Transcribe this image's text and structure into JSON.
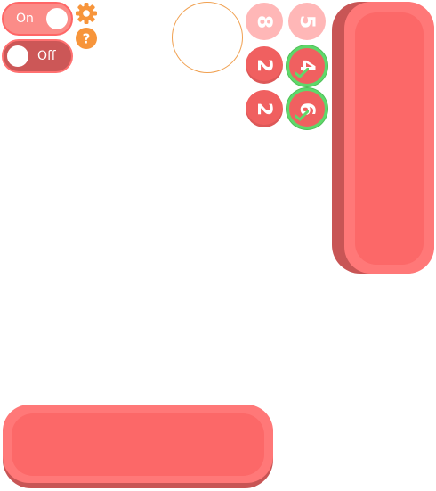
{
  "toggles": {
    "on_label": "On",
    "off_label": "Off"
  },
  "icons": {
    "settings": "gear-icon",
    "help": "help-icon",
    "help_glyph": "?"
  },
  "tiles": [
    {
      "value": "8",
      "state": "faded"
    },
    {
      "value": "5",
      "state": "faded"
    },
    {
      "value": "2",
      "state": "active"
    },
    {
      "value": "4",
      "state": "checked"
    },
    {
      "value": "2",
      "state": "active"
    },
    {
      "value": "6",
      "state": "checked"
    }
  ],
  "colors": {
    "accent": "#ff6b6b",
    "faded": "#ffb7b7",
    "check": "#5fd86a",
    "icon": "#f7953b"
  }
}
